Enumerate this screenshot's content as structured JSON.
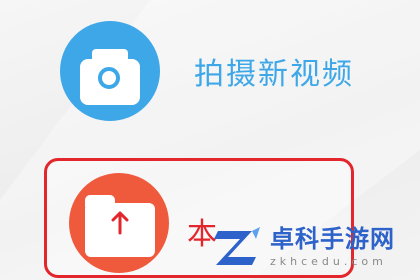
{
  "options": {
    "shoot": {
      "label": "拍摄新视频",
      "icon": "camera-icon",
      "color": "#3da7e8"
    },
    "upload": {
      "label": "本",
      "icon": "upload-folder-icon",
      "color": "#f05a3c",
      "highlight_color": "#e2262b"
    }
  },
  "watermark": {
    "name": "卓科手游网",
    "url": "zkhcedu.com"
  }
}
